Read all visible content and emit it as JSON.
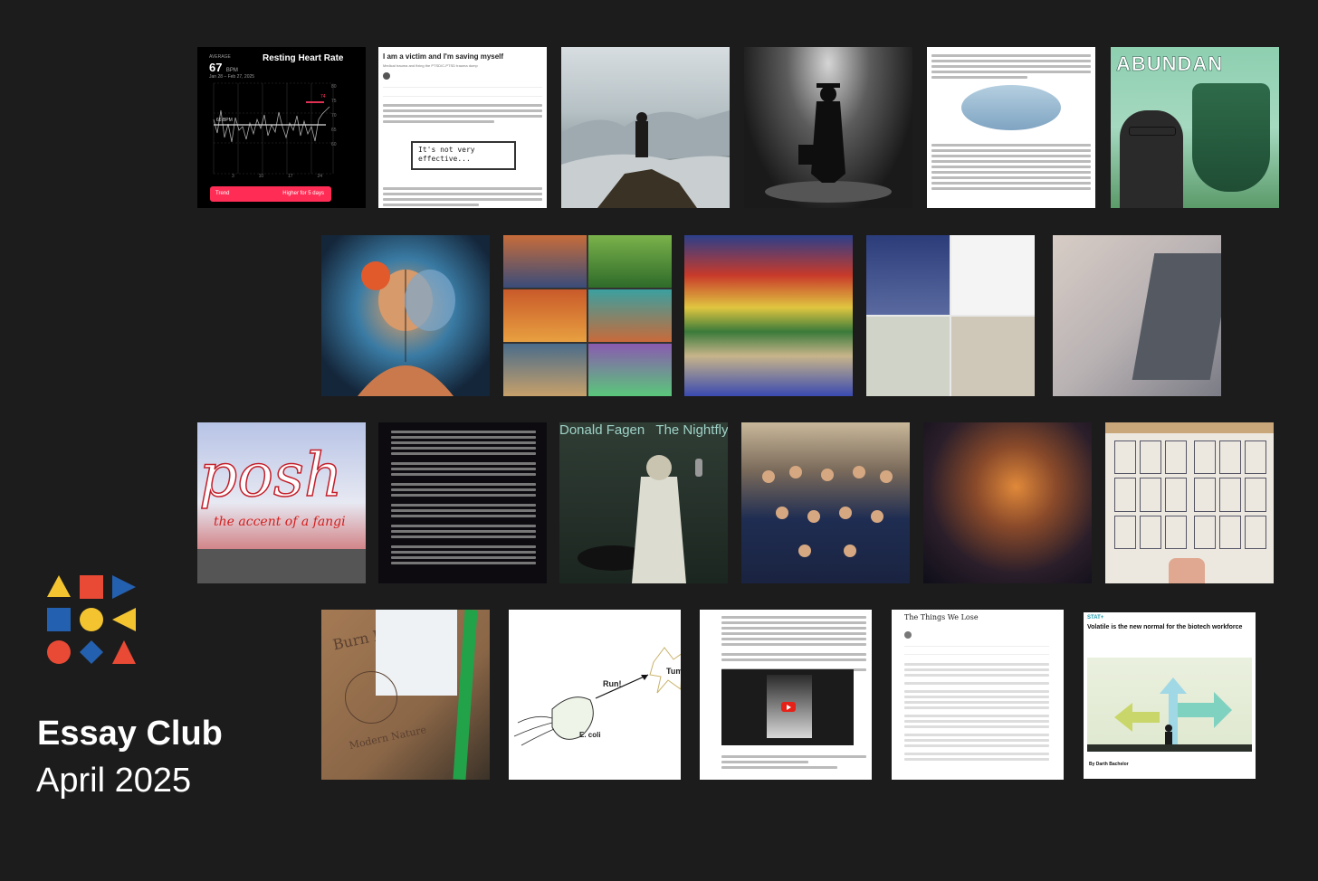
{
  "brand": {
    "title": "Essay Club",
    "date": "April 2025"
  },
  "tiles": {
    "heart": {
      "average_label": "AVERAGE",
      "value": "67",
      "unit": "BPM",
      "range": "Jan 28 – Feb 27, 2025",
      "title": "Resting Heart Rate",
      "baseline": "66 BPM",
      "current": "74",
      "y_ticks": [
        "80",
        "75",
        "70",
        "65",
        "60"
      ],
      "x_ticks": [
        "3",
        "10",
        "17",
        "24"
      ],
      "trend_label": "Trend",
      "trend_value": "Higher for 5 days"
    },
    "victim": {
      "title": "I am a victim and I'm saving myself",
      "subtitle": "Medical trauma and fixing the PTSD/C-PTSD trauma dump",
      "box_text": "It's not very effective..."
    },
    "abundance": {
      "title": "ABUNDAN"
    },
    "fagen": {
      "artist": "Donald Fagen",
      "album": "The Nightfly"
    },
    "posh": {
      "word": "posh",
      "tagline": "the accent of a fangi"
    },
    "paper": {
      "word1": "Burn Paper",
      "word2": "Modern Nature"
    },
    "ecoli": {
      "run": "Run!",
      "tumble": "Tum",
      "label": "E. coli"
    },
    "things": {
      "title": "The Things We Lose"
    },
    "stat": {
      "brand": "STAT+",
      "title": "Volatile is the new normal for the biotech workforce",
      "byline": "By Darth Bachelor"
    }
  }
}
